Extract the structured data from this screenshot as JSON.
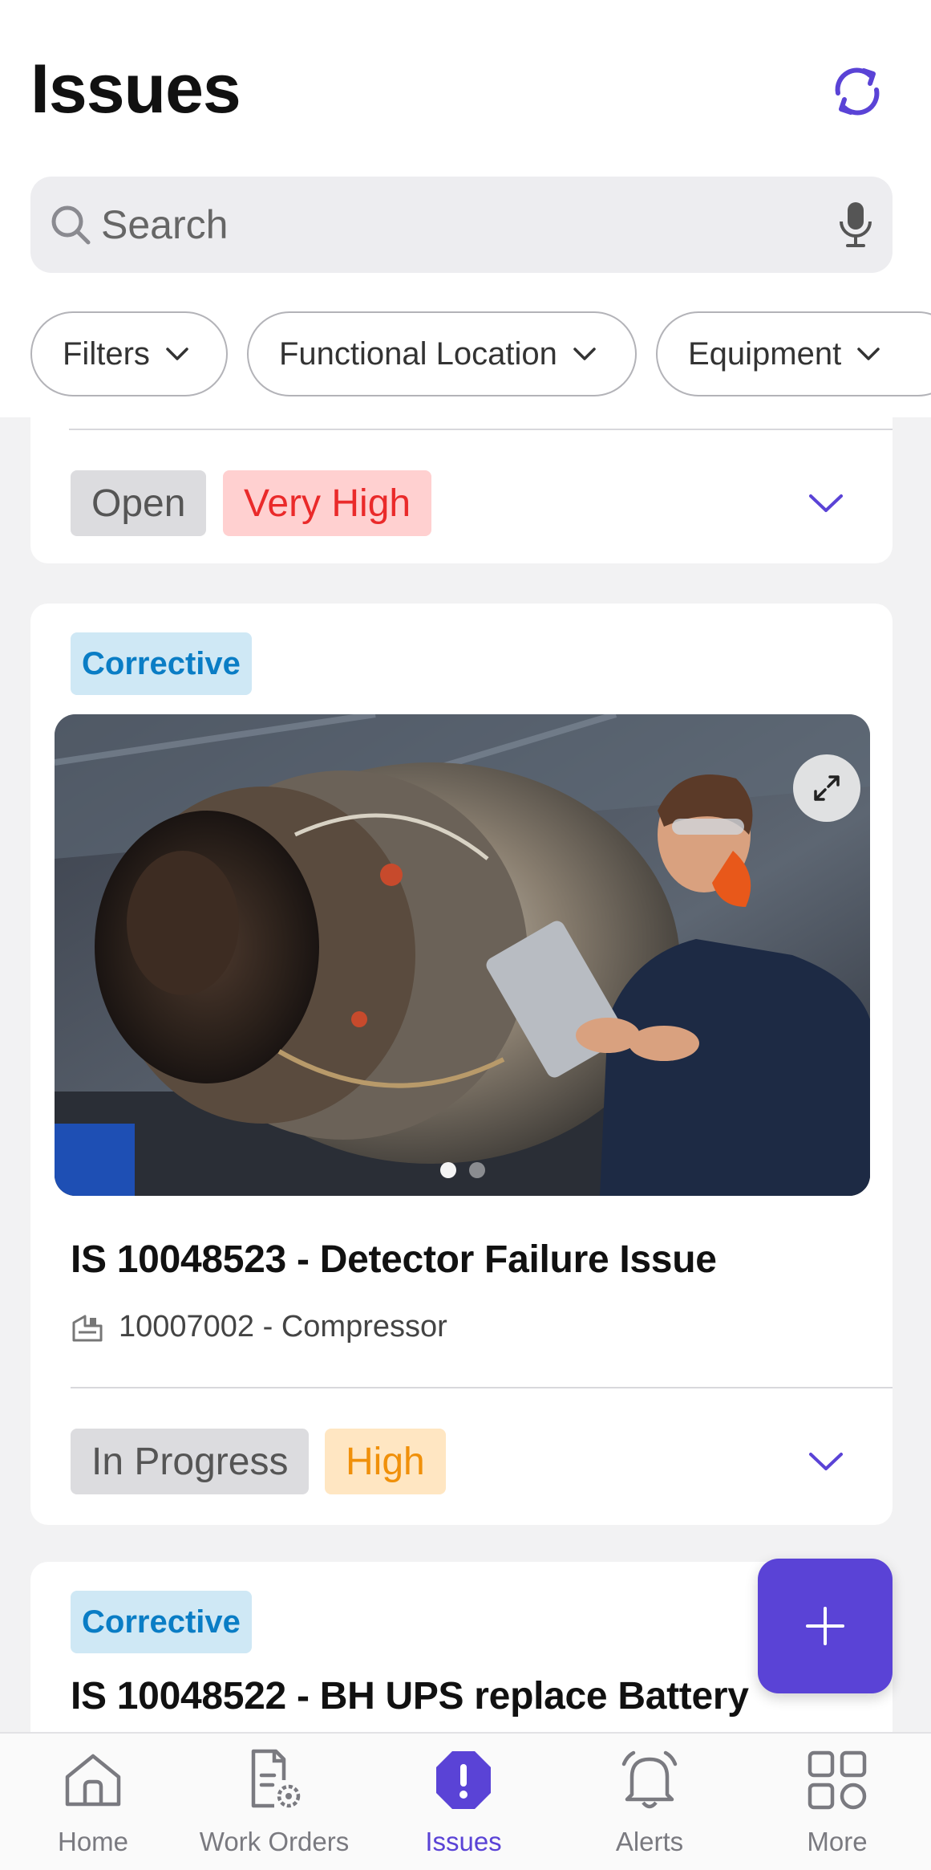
{
  "header": {
    "title": "Issues",
    "refresh_icon": "refresh-icon"
  },
  "search": {
    "placeholder": "Search",
    "value": ""
  },
  "filters": [
    {
      "label": "Filters"
    },
    {
      "label": "Functional Location"
    },
    {
      "label": "Equipment"
    }
  ],
  "issues": [
    {
      "status": "Open",
      "priority": "Very High",
      "priority_color": "#ea2a2a"
    },
    {
      "type": "Corrective",
      "title": "IS 10048523 - Detector Failure Issue",
      "equipment": "10007002 - Compressor",
      "status": "In Progress",
      "priority": "High",
      "priority_color": "#f0900a",
      "image_count": 2,
      "image_index": 1
    },
    {
      "type": "Corrective",
      "title": "IS 10048522 - BH UPS replace Battery"
    }
  ],
  "fab": {
    "icon": "plus-icon"
  },
  "tabbar": {
    "accent": "#5a43d6",
    "items": [
      {
        "label": "Home",
        "icon": "home-icon"
      },
      {
        "label": "Work Orders",
        "icon": "work-orders-icon"
      },
      {
        "label": "Issues",
        "icon": "issues-icon",
        "active": true
      },
      {
        "label": "Alerts",
        "icon": "bell-icon"
      },
      {
        "label": "More",
        "icon": "grid-icon"
      }
    ]
  }
}
